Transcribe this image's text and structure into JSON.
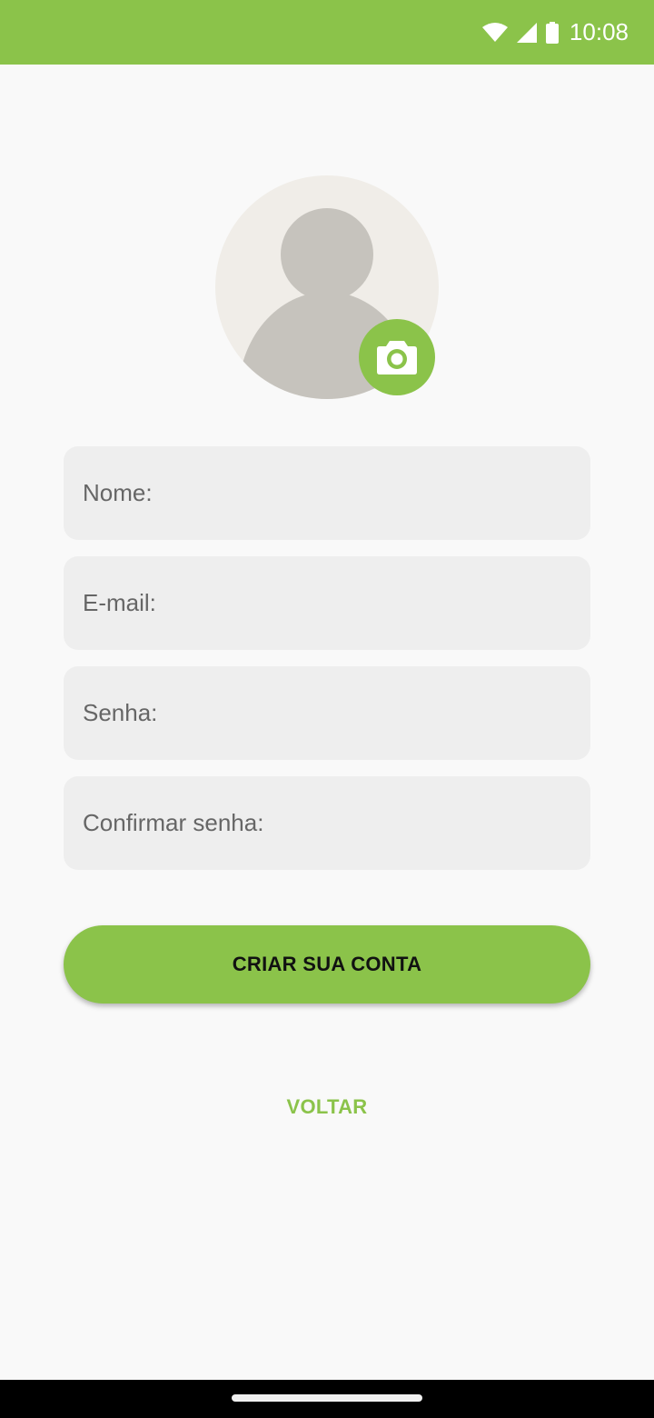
{
  "colors": {
    "accent": "#8bc34a",
    "background": "#f9f9f9",
    "field_background": "#eeeeee",
    "avatar_background": "#f0ede8",
    "avatar_silhouette": "#c6c3bd"
  },
  "status_bar": {
    "time": "10:08",
    "icons": [
      "wifi-icon",
      "signal-icon",
      "battery-icon"
    ]
  },
  "avatar": {
    "icon": "person-silhouette-icon",
    "action_icon": "camera-icon"
  },
  "form": {
    "fields": [
      {
        "label": "Nome:"
      },
      {
        "label": "E-mail:"
      },
      {
        "label": "Senha:"
      },
      {
        "label": "Confirmar senha:"
      }
    ],
    "submit_label": "CRIAR SUA CONTA",
    "back_label": "VOLTAR"
  }
}
